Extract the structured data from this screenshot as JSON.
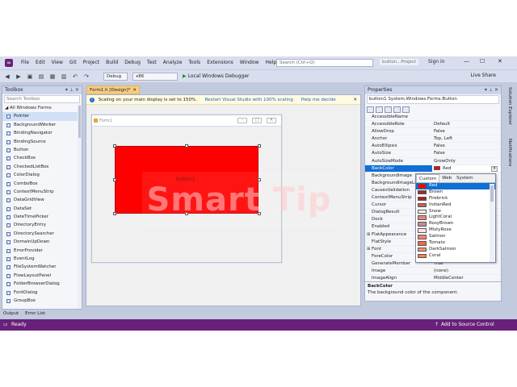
{
  "menubar": {
    "items": [
      "File",
      "Edit",
      "View",
      "Git",
      "Project",
      "Build",
      "Debug",
      "Test",
      "Analyze",
      "Tools",
      "Extensions",
      "Window",
      "Help"
    ],
    "search_placeholder": "Search (Ctrl+Q)",
    "solution_name": "button...Project",
    "signin": "Sign in"
  },
  "toolbar": {
    "config": "Debug",
    "platform": "x86",
    "run_label": "Local Windows Debugger",
    "liveshare": "Live Share"
  },
  "toolbox": {
    "title": "Toolbox",
    "search_placeholder": "Search Toolbox",
    "group": "All Windows Forms",
    "items": [
      "Pointer",
      "BackgroundWorker",
      "BindingNavigator",
      "BindingSource",
      "Button",
      "CheckBox",
      "CheckedListBox",
      "ColorDialog",
      "ComboBox",
      "ContextMenuStrip",
      "DataGridView",
      "DataSet",
      "DateTimePicker",
      "DirectoryEntry",
      "DirectorySearcher",
      "DomainUpDown",
      "ErrorProvider",
      "EventLog",
      "FileSystemWatcher",
      "FlowLayoutPanel",
      "FolderBrowserDialog",
      "FontDialog",
      "GroupBox"
    ]
  },
  "document": {
    "tab_label": "Form1.h [Design]*",
    "info_text": "Scaling on your main display is set to 150%.",
    "info_link1": "Restart Visual Studio with 100% scaling",
    "info_link2": "Help me decide",
    "form_title": "Form1",
    "button_text": "button1"
  },
  "properties": {
    "title": "Properties",
    "object": "button1  System.Windows.Forms.Button",
    "rows": [
      {
        "name": "AccessibleName",
        "value": ""
      },
      {
        "name": "AccessibleRole",
        "value": "Default"
      },
      {
        "name": "AllowDrop",
        "value": "False"
      },
      {
        "name": "Anchor",
        "value": "Top, Left"
      },
      {
        "name": "AutoEllipsis",
        "value": "False"
      },
      {
        "name": "AutoSize",
        "value": "False"
      },
      {
        "name": "AutoSizeMode",
        "value": "GrowOnly"
      },
      {
        "name": "BackColor",
        "value": "Red"
      },
      {
        "name": "BackgroundImage",
        "value": ""
      },
      {
        "name": "BackgroundImageLa",
        "value": ""
      },
      {
        "name": "CausesValidation",
        "value": ""
      },
      {
        "name": "ContextMenuStrip",
        "value": ""
      },
      {
        "name": "Cursor",
        "value": ""
      },
      {
        "name": "DialogResult",
        "value": ""
      },
      {
        "name": "Dock",
        "value": ""
      },
      {
        "name": "Enabled",
        "value": ""
      },
      {
        "name": "FlatAppearance",
        "value": ""
      },
      {
        "name": "FlatStyle",
        "value": ""
      },
      {
        "name": "Font",
        "value": ""
      },
      {
        "name": "ForeColor",
        "value": ""
      },
      {
        "name": "GenerateMember",
        "value": "True"
      },
      {
        "name": "Image",
        "value": "(none)"
      },
      {
        "name": "ImageAlign",
        "value": "MiddleCenter"
      }
    ],
    "desc_title": "BackColor",
    "desc_text": "The background color of the component."
  },
  "color_popup": {
    "tabs": [
      "Custom",
      "Web",
      "System"
    ],
    "colors": [
      {
        "name": "Red",
        "hex": "#ff0000"
      },
      {
        "name": "Brown",
        "hex": "#a52a2a"
      },
      {
        "name": "Firebrick",
        "hex": "#b22222"
      },
      {
        "name": "IndianRed",
        "hex": "#cd5c5c"
      },
      {
        "name": "Snow",
        "hex": "#fffafa"
      },
      {
        "name": "LightCoral",
        "hex": "#f08080"
      },
      {
        "name": "RosyBrown",
        "hex": "#bc8f8f"
      },
      {
        "name": "MistyRose",
        "hex": "#ffe4e1"
      },
      {
        "name": "Salmon",
        "hex": "#fa8072"
      },
      {
        "name": "Tomato",
        "hex": "#ff6347"
      },
      {
        "name": "DarkSalmon",
        "hex": "#e9967a"
      },
      {
        "name": "Coral",
        "hex": "#ff7f50"
      }
    ]
  },
  "sidetabs": [
    "Solution Explorer",
    "Notifications"
  ],
  "bottom": {
    "tabs": [
      "Output",
      "Error List"
    ],
    "status": "Ready",
    "source_control": "Add to Source Control"
  },
  "watermark": "Smart Tip",
  "colors": {
    "accent": "#68217a",
    "selection": "#0e6fd6",
    "button_back": "#ff0000"
  }
}
